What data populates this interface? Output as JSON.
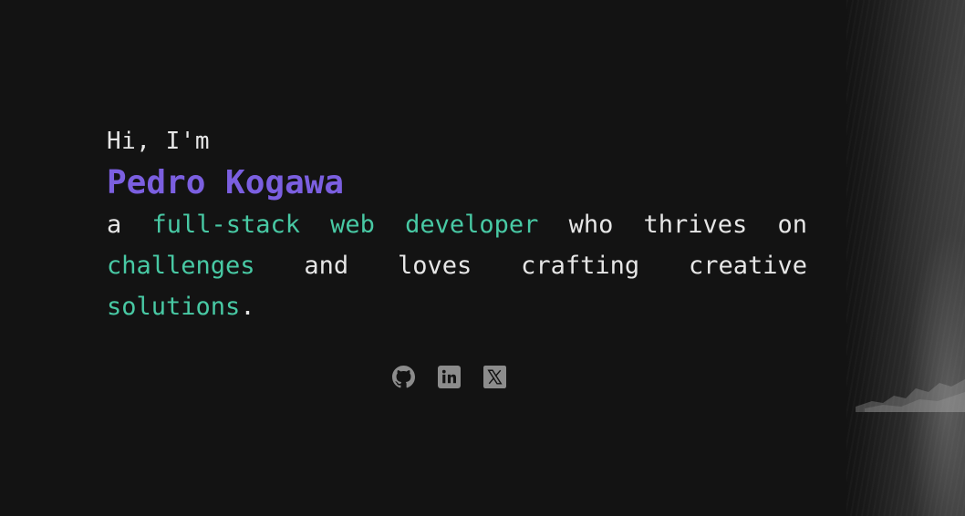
{
  "hero": {
    "greeting": "Hi, I'm",
    "name": "Pedro Kogawa",
    "tagline": {
      "a": "a",
      "role": "full-stack web developer",
      "who_thrives_on": "who thrives on",
      "challenges": "challenges",
      "and_loves_crafting_creative": "and loves crafting creative",
      "solutions": "solutions",
      "period": "."
    }
  },
  "socials": [
    {
      "icon": "github-icon"
    },
    {
      "icon": "linkedin-icon"
    },
    {
      "icon": "x-icon"
    }
  ],
  "colors": {
    "background": "#131313",
    "name": "#7b5fe0",
    "accent": "#48c9a4",
    "text": "#e6e6e6",
    "icon": "#8c8c8c"
  }
}
